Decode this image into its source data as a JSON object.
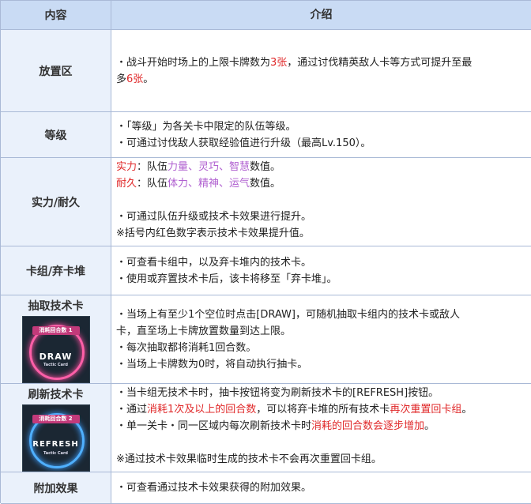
{
  "header": {
    "col1": "内容",
    "col2": "介绍"
  },
  "colors": {
    "red": "#e0292a",
    "purple": "#b060d0",
    "header_bg": "#c9dbf4",
    "label_bg": "#eaf1fb"
  },
  "rows": {
    "placement": {
      "label": "放置区",
      "line1_a": "・战斗开始时场上的上限卡牌数为",
      "line1_b": "3张",
      "line1_c": "，通过讨伐精英敌人卡等方式可提升至最",
      "line2_a": "多",
      "line2_b": "6张",
      "line2_c": "。"
    },
    "level": {
      "label": "等级",
      "line1": "・「等级」为各关卡中限定的队伍等级。",
      "line2": "・可通过讨伐敌人获取经验值进行升级（最高Lv.150）。"
    },
    "power": {
      "label": "实力/耐久",
      "l1_a": "实力",
      "l1_b": "：队伍",
      "l1_c": "力量、灵巧、智慧",
      "l1_d": "数值。",
      "l2_a": "耐久",
      "l2_b": "：队伍",
      "l2_c": "体力、精神、运气",
      "l2_d": "数值。",
      "l3": "・可通过队伍升级或技术卡效果进行提升。",
      "l4": "※括号内红色数字表示技术卡效果提升值。"
    },
    "deck": {
      "label": "卡组/弃卡堆",
      "line1": "・可查看卡组中，以及弃卡堆内的技术卡。",
      "line2": "・使用或弃置技术卡后，该卡将移至「弃卡堆」。"
    },
    "draw": {
      "label": "抽取技术卡",
      "card_tag": "消耗回合数 1",
      "card_word": "DRAW",
      "card_sub": "Tactic Card",
      "line1": "・当场上有至少1个空位时点击[DRAW]，可随机抽取卡组内的技术卡或敌人",
      "line2": "卡，直至场上卡牌放置数量到达上限。",
      "line3": "・每次抽取都将消耗1回合数。",
      "line4": "・当场上卡牌数为0时，将自动执行抽卡。"
    },
    "refresh": {
      "label": "刷新技术卡",
      "card_tag": "消耗回合数 2",
      "card_word": "REFRESH",
      "card_sub": "Tactic Card",
      "l1": "・当卡组无技术卡时，抽卡按钮将变为刷新技术卡的[REFRESH]按钮。",
      "l2_a": "・通过",
      "l2_b": "消耗1次及以上的回合数",
      "l2_c": "，可以将弃卡堆的所有技术卡",
      "l2_d": "再次重置回卡组",
      "l2_e": "。",
      "l3_a": "・单一关卡・同一区域内每次刷新技术卡时",
      "l3_b": "消耗的回合数会逐步增加",
      "l3_c": "。",
      "l4": "※通过技术卡效果临时生成的技术卡不会再次重置回卡组。"
    },
    "extra": {
      "label": "附加效果",
      "line1": "・可查看通过技术卡效果获得的附加效果。"
    }
  }
}
